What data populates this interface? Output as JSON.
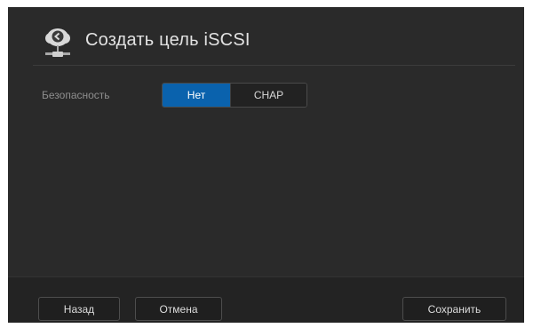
{
  "header": {
    "title": "Создать цель iSCSI",
    "icon": "network-storage-icon"
  },
  "security": {
    "label": "Безопасность",
    "options": [
      {
        "label": "Нет",
        "selected": true
      },
      {
        "label": "CHAP",
        "selected": false
      }
    ]
  },
  "footer": {
    "back_label": "Назад",
    "cancel_label": "Отмена",
    "save_label": "Сохранить"
  },
  "colors": {
    "panel": "#2a2a2a",
    "accent": "#0a62ad",
    "text": "#e2e2e2"
  }
}
